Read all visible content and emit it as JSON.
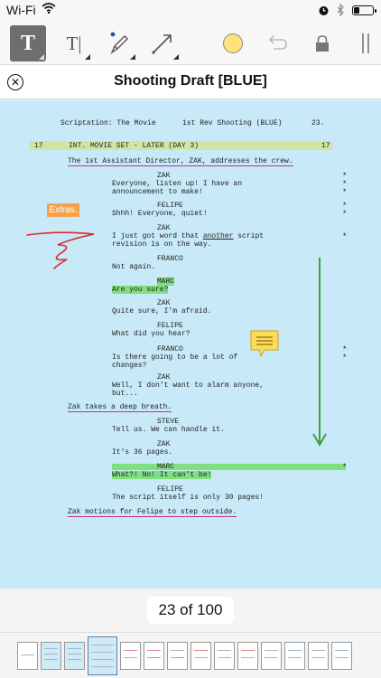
{
  "status_bar": {
    "carrier": "Wi-Fi"
  },
  "toolbar": {
    "tools": [
      "text-tool",
      "text-insert-tool",
      "pen-tool",
      "line-tool",
      "color-picker",
      "undo",
      "lock",
      "more"
    ],
    "selected_tool": "text-tool",
    "text_tool_glyph": "T",
    "text_insert_glyph": "T|",
    "highlight_color": "#ffe27a"
  },
  "title_bar": {
    "title": "Shooting Draft [BLUE]"
  },
  "script": {
    "header": {
      "show": "Scriptation: The Movie",
      "revision": "1st Rev Shooting (BLUE)",
      "page_number": "23."
    },
    "scene": {
      "number": "17",
      "heading": "INT. MOVIE SET - LATER (DAY 3)"
    },
    "action_1": "The 1st Assistant Director, ZAK, addresses the crew.",
    "dialogue": [
      {
        "character": "ZAK",
        "lines": [
          "Everyone, listen up! I have an",
          "announcement to make!"
        ]
      },
      {
        "character": "FELIPE",
        "lines": [
          "Shhh! Everyone, quiet!"
        ]
      },
      {
        "character": "ZAK",
        "lines_html_parts": [
          "I just got word that ",
          "another",
          " script"
        ],
        "line_2": "revision is on the way."
      },
      {
        "character": "FRANCO",
        "lines": [
          "Not again."
        ]
      },
      {
        "character": "MARC",
        "lines": [
          "Are you sure?"
        ]
      },
      {
        "character": "ZAK",
        "lines": [
          "Quite sure, I'm afraid."
        ]
      },
      {
        "character": "FELIPE",
        "lines": [
          "What did you hear?"
        ]
      },
      {
        "character": "FRANCO",
        "lines": [
          "Is there going to be a lot of",
          "changes?"
        ]
      },
      {
        "character": "ZAK",
        "lines": [
          "Well, I don't want to alarm anyone,",
          "but..."
        ]
      }
    ],
    "action_2": "Zak takes a deep breath.",
    "dialogue_2": [
      {
        "character": "STEVE",
        "lines": [
          "Tell us. We can handle it."
        ]
      },
      {
        "character": "ZAK",
        "lines": [
          "It's 36 pages."
        ]
      },
      {
        "character": "MARC",
        "lines": [
          "What?! No! It can't be!"
        ]
      },
      {
        "character": "FELIPE",
        "lines": [
          "The script itself is only 30 pages!"
        ]
      }
    ],
    "action_3": "Zak motions for Felipe to step outside.",
    "revision_mark": "*",
    "annotations": {
      "extras_label": "Extras."
    }
  },
  "page_counter": {
    "text": "23 of 100",
    "current": 23,
    "total": 100
  },
  "colors": {
    "page_bg": "#c8e9f8",
    "scene_highlight": "#cfe6a2",
    "marc_highlight": "#7fe07f",
    "arrow": "#3aa33a",
    "scribble": "#e0262e",
    "underline": "#c0338c",
    "extras_tag": "#f6a24d"
  }
}
